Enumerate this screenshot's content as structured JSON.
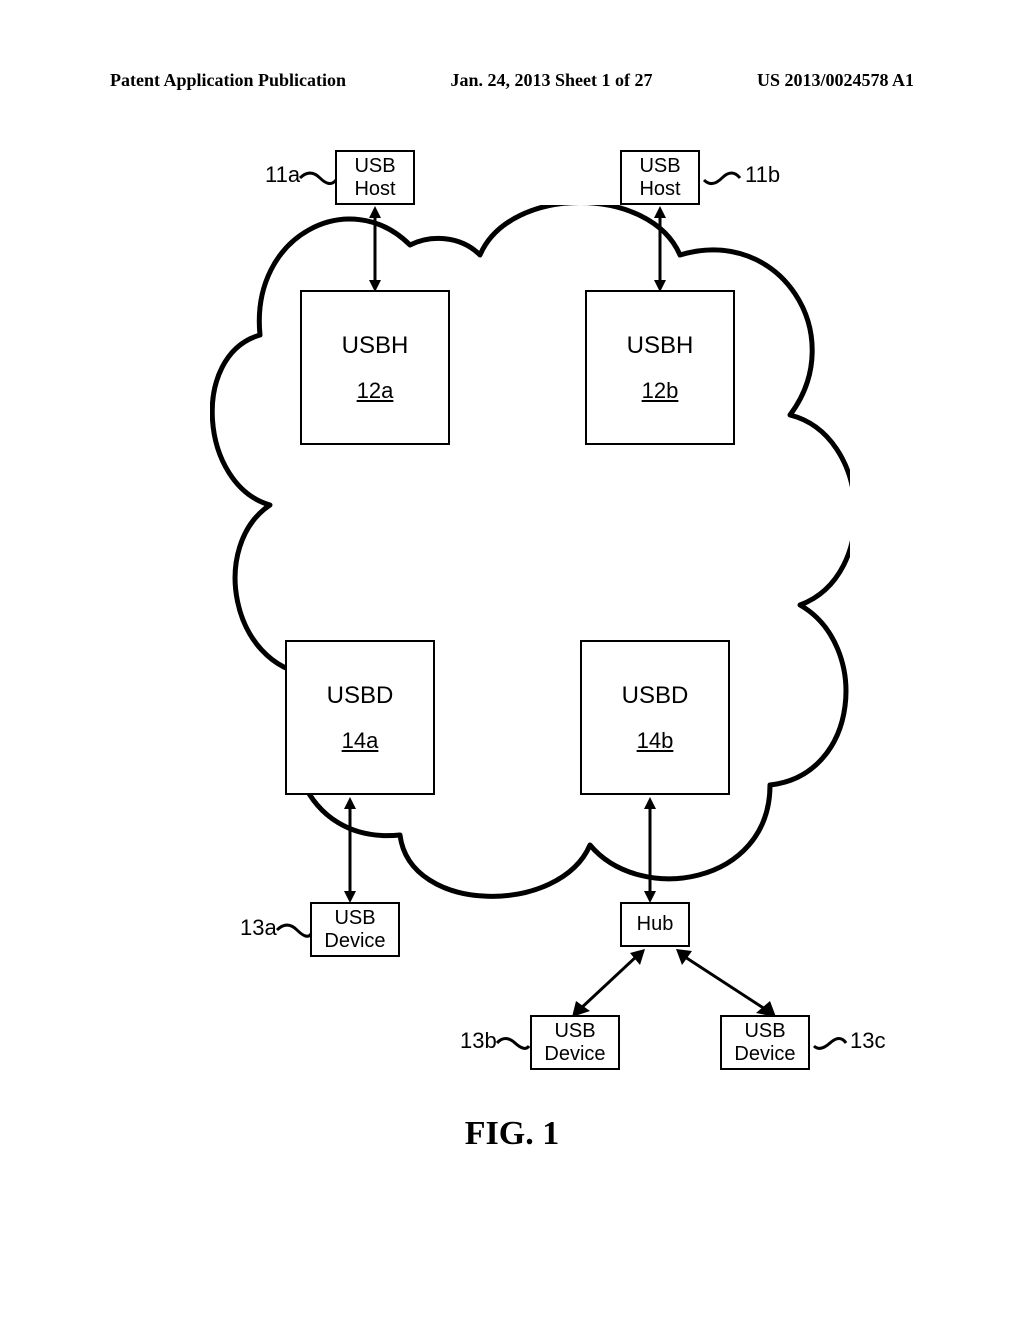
{
  "header": {
    "left": "Patent Application Publication",
    "center": "Jan. 24, 2013  Sheet 1 of 27",
    "right": "US 2013/0024578 A1"
  },
  "labels": {
    "r11a": "11a",
    "r11b": "11b",
    "r13a": "13a",
    "r13b": "13b",
    "r13c": "13c"
  },
  "boxes": {
    "usbhost_a": {
      "line1": "USB",
      "line2": "Host"
    },
    "usbhost_b": {
      "line1": "USB",
      "line2": "Host"
    },
    "usbh_a": {
      "title": "USBH",
      "ref": "12a"
    },
    "usbh_b": {
      "title": "USBH",
      "ref": "12b"
    },
    "usbd_a": {
      "title": "USBD",
      "ref": "14a"
    },
    "usbd_b": {
      "title": "USBD",
      "ref": "14b"
    },
    "usbdevice_a": {
      "line1": "USB",
      "line2": "Device"
    },
    "hub": {
      "line1": "Hub"
    },
    "usbdevice_b": {
      "line1": "USB",
      "line2": "Device"
    },
    "usbdevice_c": {
      "line1": "USB",
      "line2": "Device"
    }
  },
  "figure": "FIG. 1"
}
